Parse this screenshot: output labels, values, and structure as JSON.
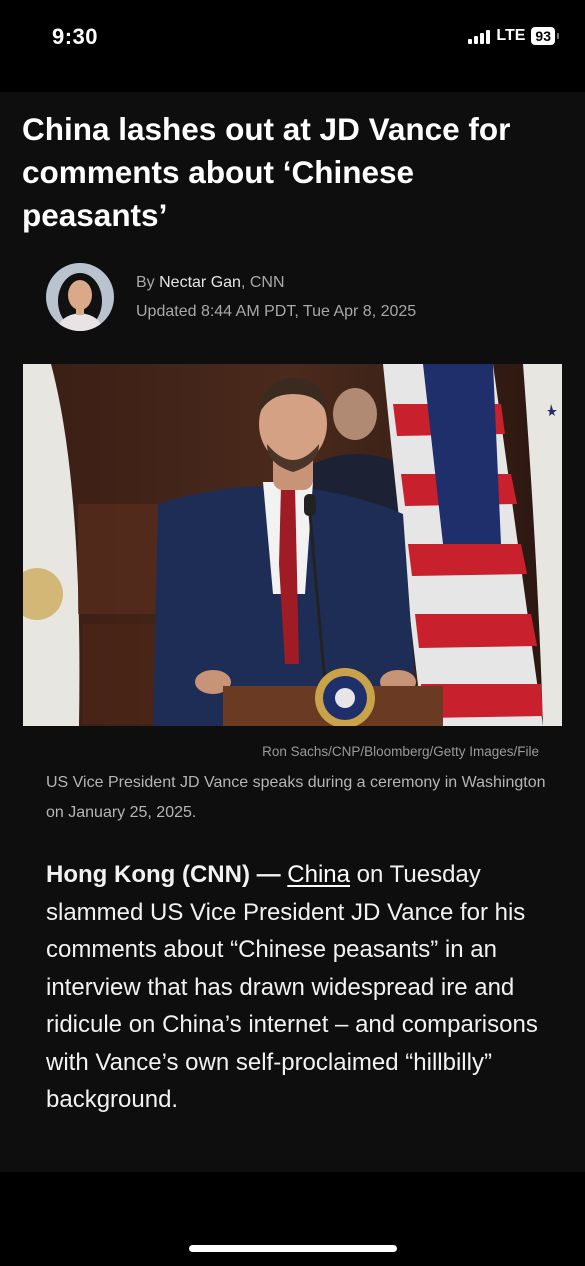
{
  "status_bar": {
    "time": "9:30",
    "network": "LTE",
    "battery": "93",
    "signal_icon": "cellular-signal-icon"
  },
  "article": {
    "headline": "China lashes out at JD Vance for comments about ‘Chinese peasants’",
    "byline": {
      "prefix": "By ",
      "author": "Nectar Gan",
      "outlet": ", CNN",
      "updated": "Updated 8:44 AM PDT, Tue Apr 8, 2025"
    },
    "photo": {
      "credit": "Ron Sachs/CNP/Bloomberg/Getty Images/File",
      "caption": "US Vice President JD Vance speaks during a ceremony in Washington on January 25, 2025."
    },
    "body": {
      "lead": "Hong Kong (CNN) — ",
      "link": "China",
      "text": " on Tuesday slammed US Vice President JD Vance for his comments about “Chinese peasants” in an interview that has drawn widespread ire and ridicule on China’s internet – and comparisons with Vance’s own self-proclaimed “hillbilly” background."
    }
  },
  "colors": {
    "page_background": "#0e0e0e",
    "chrome_background": "#000000",
    "text_primary": "#ffffff",
    "text_secondary": "#a8a8a8"
  }
}
